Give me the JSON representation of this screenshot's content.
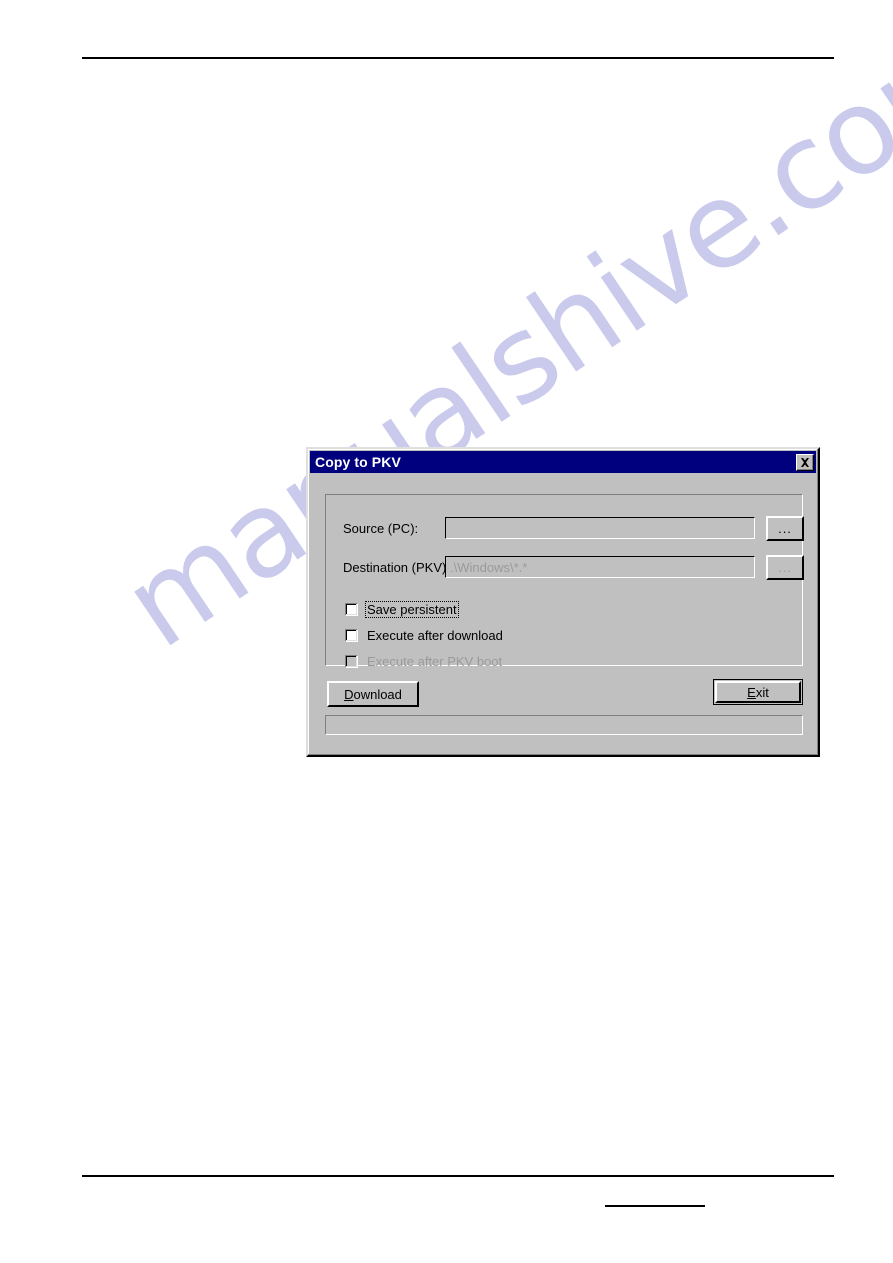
{
  "document": {
    "has_header_rule": true,
    "has_footer_rule": true,
    "footer_field_blank": ""
  },
  "watermark": {
    "text": "manualshive.com",
    "color": "#c9caec"
  },
  "dialog": {
    "title": "Copy to PKV",
    "titlebar_color": "#00007e",
    "face_color": "#c0c0c0",
    "close_icon": "close-icon",
    "fields": [
      {
        "label": "Source (PC):",
        "value": "",
        "placeholder": "",
        "browse_label": "...",
        "disabled": false
      },
      {
        "label": "Destination (PKV):",
        "value": ".\\Windows\\*.*",
        "placeholder": "",
        "browse_label": "...",
        "disabled": true
      }
    ],
    "checkboxes": [
      {
        "label": "Save persistent",
        "checked": false,
        "disabled": false,
        "focused": true
      },
      {
        "label": "Execute after download",
        "checked": false,
        "disabled": false,
        "focused": false
      },
      {
        "label": "Execute after PKV boot",
        "checked": false,
        "disabled": true,
        "focused": false
      }
    ],
    "buttons": {
      "download": {
        "accel": "D",
        "rest": "ownload"
      },
      "exit": {
        "accel": "E",
        "rest": "xit"
      }
    },
    "statusbar": {
      "text": ""
    }
  }
}
